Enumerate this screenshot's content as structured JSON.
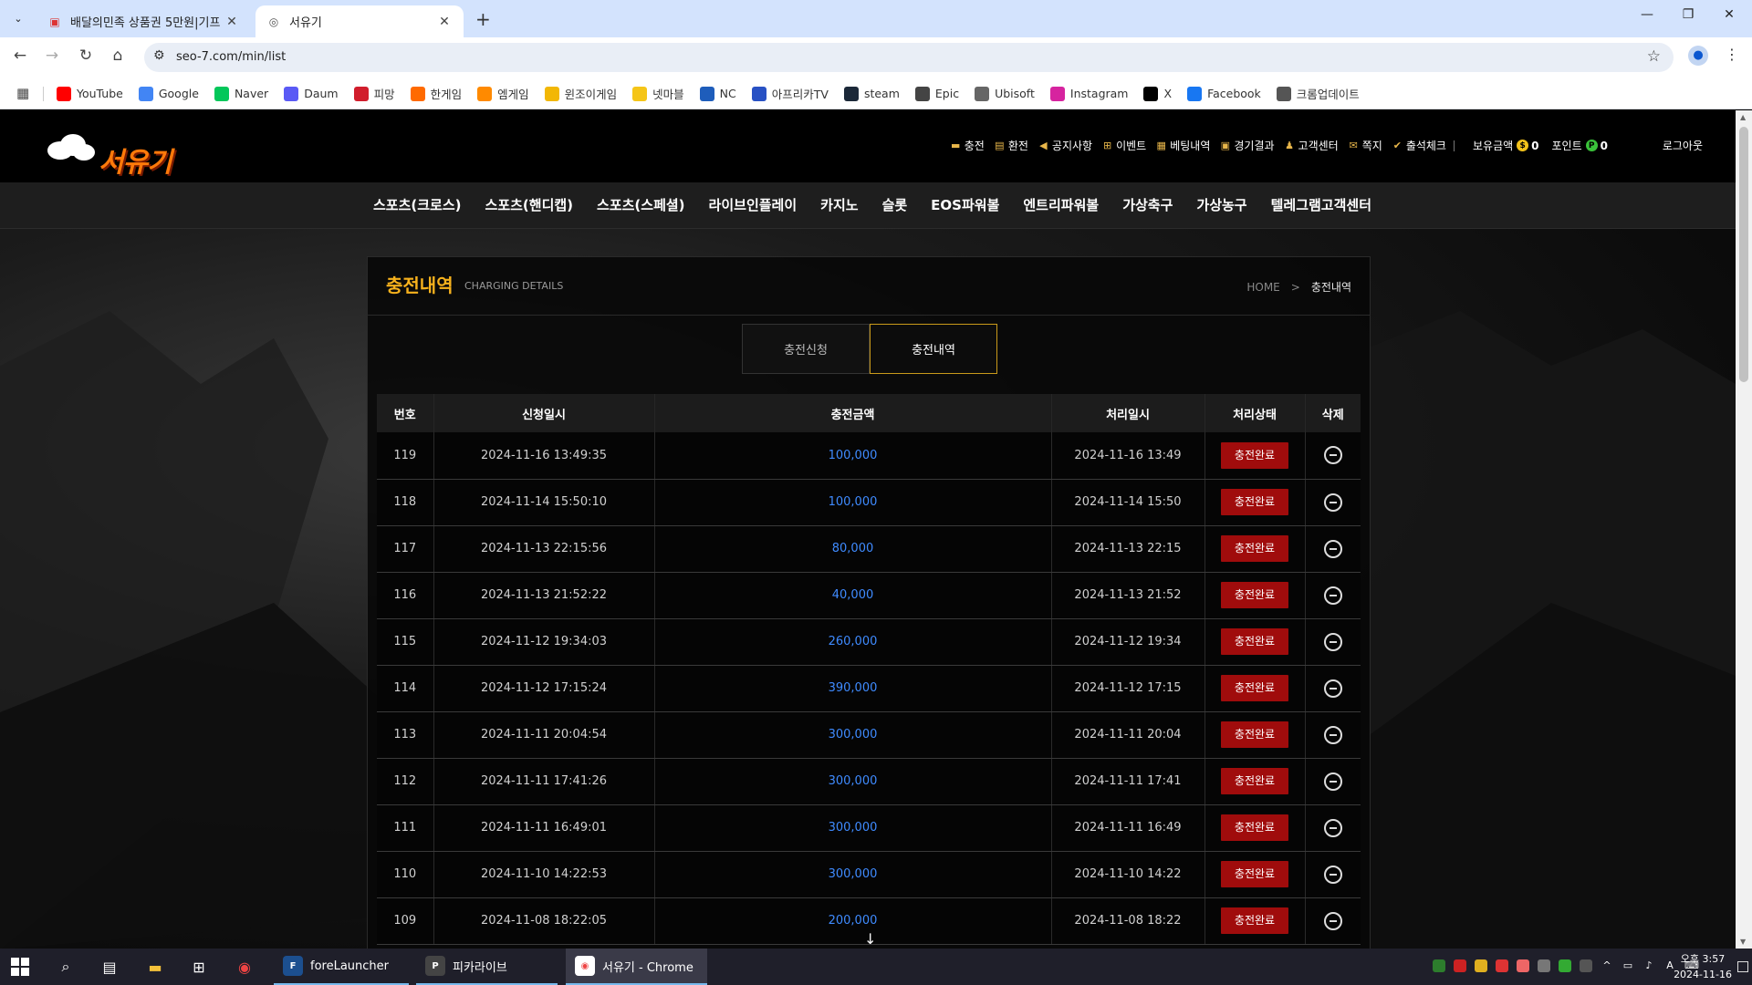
{
  "browser": {
    "tabs": [
      {
        "title": "배달의민족 상품권 5만원|기프",
        "active": false
      },
      {
        "title": "서유기",
        "active": true
      }
    ],
    "url": "seo-7.com/min/list",
    "bookmarks": [
      {
        "label": "YouTube",
        "color": "#ff0000",
        "icon": "youtube-icon"
      },
      {
        "label": "Google",
        "color": "#4285f4",
        "icon": "google-icon"
      },
      {
        "label": "Naver",
        "color": "#03c75a",
        "icon": "naver-icon"
      },
      {
        "label": "Daum",
        "color": "#5a5af5",
        "icon": "daum-icon"
      },
      {
        "label": "피망",
        "color": "#d11d2c",
        "icon": "pmang-icon"
      },
      {
        "label": "한게임",
        "color": "#ff6a00",
        "icon": "hangame-icon"
      },
      {
        "label": "엠게임",
        "color": "#ff8a00",
        "icon": "mgame-icon"
      },
      {
        "label": "윈조이게임",
        "color": "#f2b705",
        "icon": "winjoy-icon"
      },
      {
        "label": "넷마블",
        "color": "#f5c518",
        "icon": "netmarble-icon"
      },
      {
        "label": "NC",
        "color": "#1e5dbb",
        "icon": "nc-icon"
      },
      {
        "label": "아프리카TV",
        "color": "#2851c4",
        "icon": "afreecatv-icon"
      },
      {
        "label": "steam",
        "color": "#1b2838",
        "icon": "steam-icon"
      },
      {
        "label": "Epic",
        "color": "#444444",
        "icon": "epic-icon"
      },
      {
        "label": "Ubisoft",
        "color": "#666666",
        "icon": "ubisoft-icon"
      },
      {
        "label": "Instagram",
        "color": "#d6249f",
        "icon": "instagram-icon"
      },
      {
        "label": "X",
        "color": "#000000",
        "icon": "x-icon"
      },
      {
        "label": "Facebook",
        "color": "#1877f2",
        "icon": "facebook-icon"
      },
      {
        "label": "크롬업데이트",
        "color": "#555555",
        "icon": "gear-icon"
      }
    ]
  },
  "site": {
    "logo_text": "서유기",
    "topmenu": [
      {
        "label": "충전",
        "icon": "charge-icon"
      },
      {
        "label": "환전",
        "icon": "exchange-icon"
      },
      {
        "label": "공지사항",
        "icon": "megaphone-icon"
      },
      {
        "label": "이벤트",
        "icon": "gift-icon"
      },
      {
        "label": "베팅내역",
        "icon": "betting-icon"
      },
      {
        "label": "경기결과",
        "icon": "result-icon"
      },
      {
        "label": "고객센터",
        "icon": "support-icon"
      },
      {
        "label": "쪽지",
        "icon": "note-icon"
      },
      {
        "label": "출석체크",
        "icon": "attendance-icon"
      }
    ],
    "balance_label": "보유금액",
    "balance_value": "0",
    "balance_coin": "$",
    "point_label": "포인트",
    "point_value": "0",
    "point_coin": "P",
    "logout": "로그아웃",
    "mainnav": [
      "스포츠(크로스)",
      "스포츠(핸디캡)",
      "스포츠(스페셜)",
      "라이브인플레이",
      "카지노",
      "슬롯",
      "EOS파워볼",
      "엔트리파워볼",
      "가상축구",
      "가상농구",
      "텔레그램고객센터"
    ]
  },
  "panel": {
    "title": "충전내역",
    "subtitle": "CHARGING DETAILS",
    "breadcrumb_home": "HOME",
    "breadcrumb_sep": ">",
    "breadcrumb_current": "충전내역",
    "tabs": [
      "충전신청",
      "충전내역"
    ],
    "columns": [
      "번호",
      "신청일시",
      "충전금액",
      "처리일시",
      "처리상태",
      "삭제"
    ],
    "rows": [
      {
        "no": "119",
        "requested": "2024-11-16 13:49:35",
        "amount": "100,000",
        "processed": "2024-11-16 13:49",
        "status": "충전완료"
      },
      {
        "no": "118",
        "requested": "2024-11-14 15:50:10",
        "amount": "100,000",
        "processed": "2024-11-14 15:50",
        "status": "충전완료"
      },
      {
        "no": "117",
        "requested": "2024-11-13 22:15:56",
        "amount": "80,000",
        "processed": "2024-11-13 22:15",
        "status": "충전완료"
      },
      {
        "no": "116",
        "requested": "2024-11-13 21:52:22",
        "amount": "40,000",
        "processed": "2024-11-13 21:52",
        "status": "충전완료"
      },
      {
        "no": "115",
        "requested": "2024-11-12 19:34:03",
        "amount": "260,000",
        "processed": "2024-11-12 19:34",
        "status": "충전완료"
      },
      {
        "no": "114",
        "requested": "2024-11-12 17:15:24",
        "amount": "390,000",
        "processed": "2024-11-12 17:15",
        "status": "충전완료"
      },
      {
        "no": "113",
        "requested": "2024-11-11 20:04:54",
        "amount": "300,000",
        "processed": "2024-11-11 20:04",
        "status": "충전완료"
      },
      {
        "no": "112",
        "requested": "2024-11-11 17:41:26",
        "amount": "300,000",
        "processed": "2024-11-11 17:41",
        "status": "충전완료"
      },
      {
        "no": "111",
        "requested": "2024-11-11 16:49:01",
        "amount": "300,000",
        "processed": "2024-11-11 16:49",
        "status": "충전완료"
      },
      {
        "no": "110",
        "requested": "2024-11-10 14:22:53",
        "amount": "300,000",
        "processed": "2024-11-10 14:22",
        "status": "충전완료"
      },
      {
        "no": "109",
        "requested": "2024-11-08 18:22:05",
        "amount": "200,000",
        "processed": "2024-11-08 18:22",
        "status": "충전완료"
      }
    ]
  },
  "taskbar": {
    "apps": [
      {
        "label": "foreLauncher",
        "icon": "forelauncher-icon"
      },
      {
        "label": "피카라이브",
        "icon": "pikalive-icon"
      },
      {
        "label": "서유기 - Chrome",
        "icon": "chrome-icon"
      }
    ],
    "clock_time": "오후 3:57",
    "clock_date": "2024-11-16",
    "ime": "A"
  },
  "colors": {
    "accent": "#f7b21d",
    "amount": "#3f8bff",
    "status": "#a00c0c"
  }
}
